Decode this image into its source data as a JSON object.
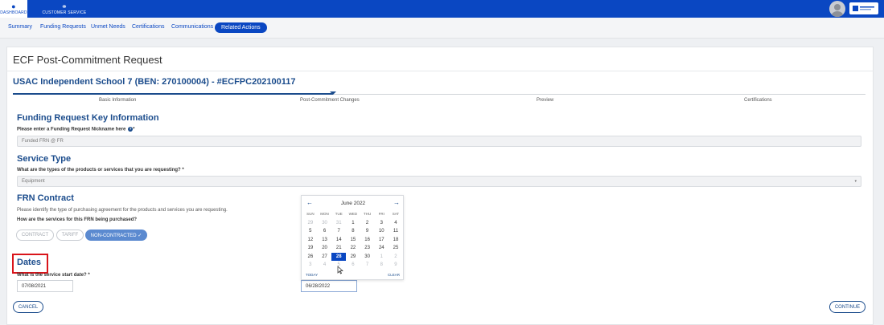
{
  "topbar": {
    "dashboard_label": "DASHBOARD",
    "customer_service_label": "CUSTOMER SERVICE",
    "dashboard_icon": "dashboard-icon",
    "customer_service_icon": "headset-icon",
    "brand_color": "#0a47c2"
  },
  "subnav": {
    "items": [
      "Summary",
      "Funding Requests",
      "Unmet Needs",
      "Certifications",
      "Communications",
      "Related Actions"
    ],
    "active": "Related Actions"
  },
  "page": {
    "title": "ECF Post-Commitment Request",
    "entity": "USAC Independent School 7 (BEN: 270100004) - #ECFPC202100117"
  },
  "stepper": {
    "steps": [
      "Basic Information",
      "Post-Commitment Changes",
      "Preview",
      "Certifications"
    ],
    "current": "Post-Commitment Changes"
  },
  "key_info": {
    "heading": "Funding Request Key Information",
    "label": "Please enter a Funding Request Nickname here",
    "required": "*",
    "value": "Funded FRN @ FR"
  },
  "service_type": {
    "heading": "Service Type",
    "label": "What are the types of the products or services that you are requesting?",
    "required": "*",
    "value": "Equipment",
    "caret": "▾"
  },
  "frn_contract": {
    "heading": "FRN Contract",
    "help": "Please identify the type of purchasing agreement for the products and services you are requesting.",
    "question": "How are the services for this FRN being purchased?",
    "options": [
      "CONTRACT",
      "TARIFF",
      "NON-CONTRACTED ✓"
    ],
    "selected": "NON-CONTRACTED"
  },
  "dates": {
    "heading": "Dates",
    "label": "What is the service start date?",
    "required": "*",
    "start_value": "07/08/2021",
    "picker_value": "06/28/2022"
  },
  "calendar": {
    "month": "June 2022",
    "prev": "←",
    "next": "→",
    "weekdays": [
      "SUN",
      "MON",
      "TUE",
      "WED",
      "THU",
      "FRI",
      "SAT"
    ],
    "weeks": [
      [
        "29",
        "30",
        "31",
        "1",
        "2",
        "3",
        "4"
      ],
      [
        "5",
        "6",
        "7",
        "8",
        "9",
        "10",
        "11"
      ],
      [
        "12",
        "13",
        "14",
        "15",
        "16",
        "17",
        "18"
      ],
      [
        "19",
        "20",
        "21",
        "22",
        "23",
        "24",
        "25"
      ],
      [
        "26",
        "27",
        "28",
        "29",
        "30",
        "1",
        "2"
      ],
      [
        "3",
        "4",
        "5",
        "6",
        "7",
        "8",
        "9"
      ]
    ],
    "selected_day": "28",
    "today_label": "TODAY",
    "clear_label": "CLEAR"
  },
  "actions": {
    "cancel": "CANCEL",
    "continue": "CONTINUE"
  }
}
